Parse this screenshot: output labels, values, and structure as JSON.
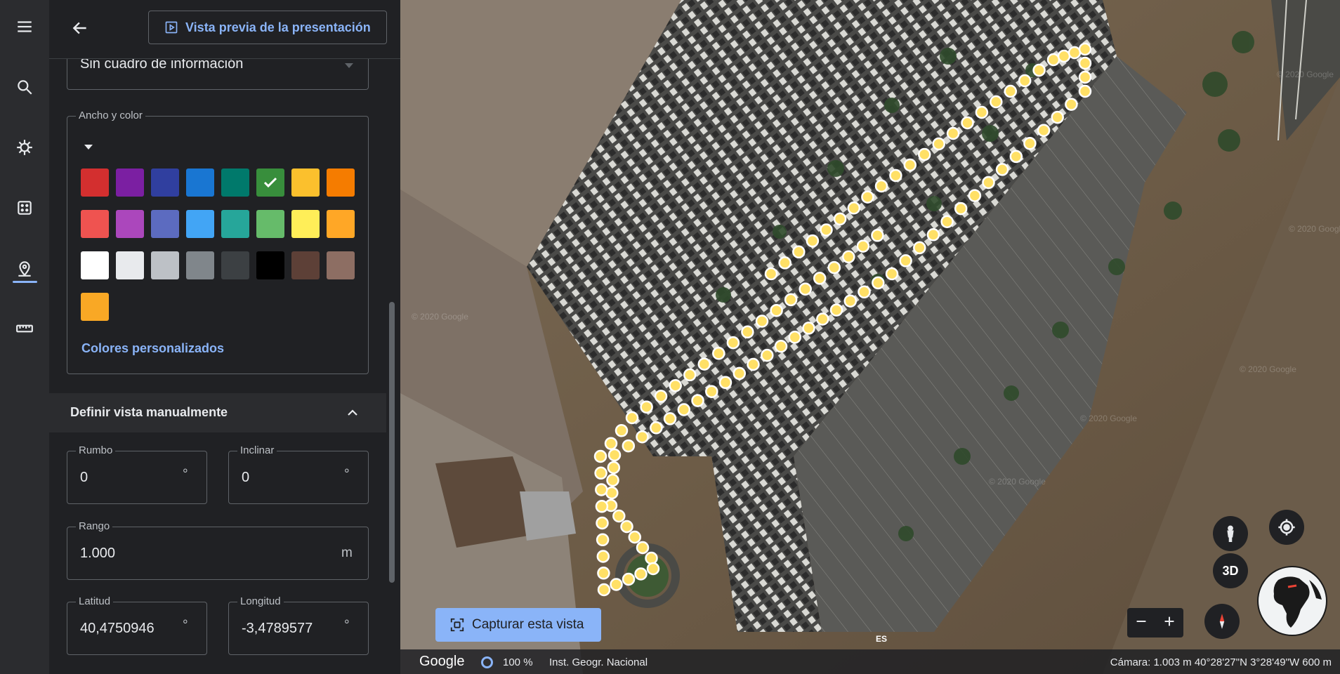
{
  "panel": {
    "preview_button": "Vista previa de la presentación",
    "info_box_value": "Sin cuadro de información",
    "color_section_label": "Ancho y color",
    "custom_colors_link": "Colores personalizados",
    "selected_color": "#388e3c",
    "swatch_rows": [
      [
        "#d32f2f",
        "#7b1fa2",
        "#303f9f",
        "#1976d2",
        "#00796b",
        "#388e3c",
        "#fbc02d",
        "#f57c00"
      ],
      [
        "#ef5350",
        "#ab47bc",
        "#5c6bc0",
        "#42a5f5",
        "#26a69a",
        "#66bb6a",
        "#ffee58",
        "#ffa726"
      ],
      [
        "#ffffff",
        "#e8eaed",
        "#bdc1c6",
        "#80868b",
        "#3c4043",
        "#000000",
        "#5d4037",
        "#8d6e63"
      ],
      [
        "#f9a825"
      ]
    ],
    "manual_view_title": "Definir vista manualmente",
    "fields": {
      "heading": {
        "label": "Rumbo",
        "value": "0",
        "unit": "°"
      },
      "tilt": {
        "label": "Inclinar",
        "value": "0",
        "unit": "°"
      },
      "range": {
        "label": "Rango",
        "value": "1.000",
        "unit": "m"
      },
      "latitude": {
        "label": "Latitud",
        "value": "40,4750946",
        "unit": "°"
      },
      "longitude": {
        "label": "Longitud",
        "value": "-3,4789577",
        "unit": "°"
      }
    }
  },
  "rail": {
    "icons": [
      "menu-icon",
      "search-icon",
      "voyager-icon",
      "feeling-lucky-icon",
      "projects-icon",
      "measure-icon"
    ],
    "active": "projects-icon"
  },
  "map": {
    "capture_button": "Capturar esta vista",
    "google": "Google",
    "streaming_percent": "100 %",
    "attribution": "Inst. Geogr. Nacional",
    "camera_info": "Cámara: 1.003 m   40°28'27\"N 3°28'49\"W   600 m",
    "language": "ES",
    "btn_3d": "3D",
    "watermarks": [
      "© 2020 Google",
      "© 2020 Google",
      "© 2020 Google",
      "© 2020 Google",
      "© 2020 Google",
      "© 2020 Google"
    ],
    "path_color": "#ffe066"
  }
}
